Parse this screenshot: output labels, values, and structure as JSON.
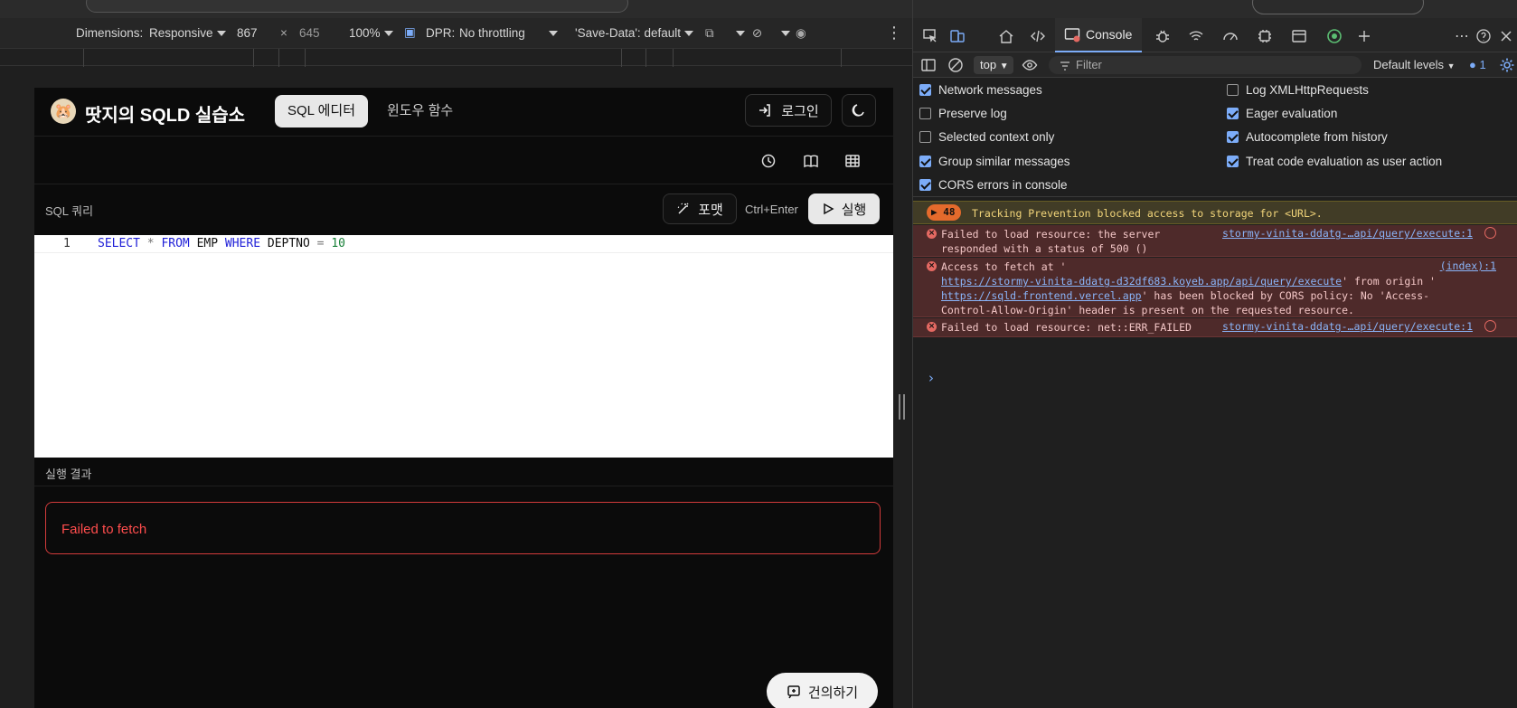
{
  "emulation": {
    "dimensions_label": "Dimensions:",
    "dimensions_mode": "Responsive",
    "width": "867",
    "height": "645",
    "zoom": "100%",
    "dpr_label": "DPR:",
    "throttling": "No throttling",
    "save_data": "'Save-Data': default"
  },
  "app": {
    "title": "땃지의 SQLD 실습소",
    "nav": [
      "SQL 에디터",
      "윈도우 함수"
    ],
    "login_label": "로그인",
    "query_label": "SQL 쿼리",
    "format_label": "포맷",
    "shortcut": "Ctrl+Enter",
    "run_label": "실행",
    "line_number": "1",
    "result_label": "실행 결과",
    "error_message": "Failed to fetch",
    "suggest_label": "건의하기"
  },
  "devtools": {
    "console_tab": "Console",
    "context": "top",
    "filter_placeholder": "Filter",
    "levels": "Default levels",
    "issues_count": "1",
    "options": [
      {
        "label": "Network messages",
        "checked": true
      },
      {
        "label": "Preserve log",
        "checked": false
      },
      {
        "label": "Selected context only",
        "checked": false
      },
      {
        "label": "Group similar messages",
        "checked": true
      },
      {
        "label": "CORS errors in console",
        "checked": true
      },
      {
        "label": "Log XMLHttpRequests",
        "checked": false
      },
      {
        "label": "Eager evaluation",
        "checked": true
      },
      {
        "label": "Autocomplete from history",
        "checked": true
      },
      {
        "label": "Treat code evaluation as user action",
        "checked": true
      }
    ],
    "warning": {
      "count": "48",
      "text": "Tracking Prevention blocked access to storage for <URL>."
    },
    "errors": {
      "e1_line1": "Failed to load resource: the server",
      "e1_line2": "responded with a status of 500 ()",
      "e1_src": "stormy-vinita-ddatg-…api/query/execute:1",
      "e2_line1": "Access to fetch at '",
      "e2_url1": "https://stormy-vinita-ddatg-d32df683.koyeb.app/api/query/execute",
      "e2_mid": "' from origin '",
      "e2_url2": "https://sqld-frontend.vercel.app",
      "e2_rest": "' has been blocked by CORS policy: No 'Access-",
      "e2_line4": "Control-Allow-Origin' header is present on the requested resource.",
      "e2_src": "(index):1",
      "e3_line": "Failed to load resource: net::ERR_FAILED",
      "e3_src": "stormy-vinita-ddatg-…api/query/execute:1"
    },
    "prompt": "›"
  }
}
